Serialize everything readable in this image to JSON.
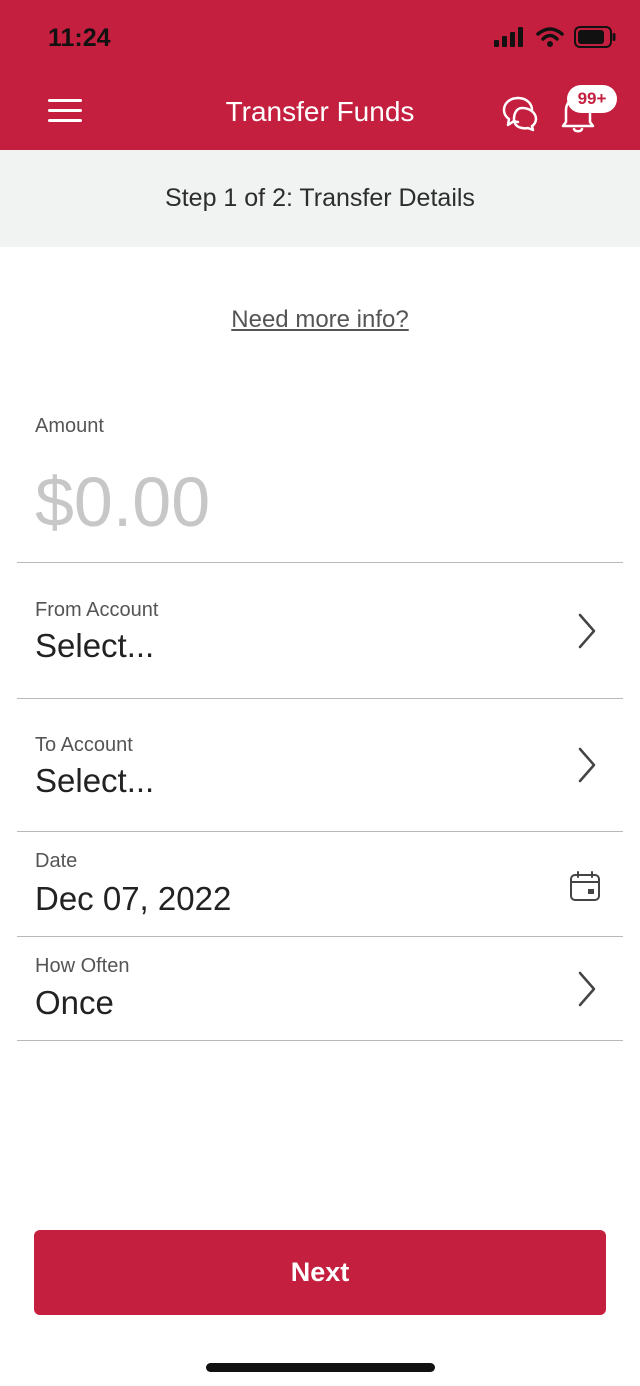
{
  "status_bar": {
    "time": "11:24"
  },
  "header": {
    "title": "Transfer Funds",
    "notification_badge": "99+",
    "brand_color": "#c41f3e"
  },
  "step": {
    "label": "Step 1 of 2: Transfer Details"
  },
  "info_link": "Need more info?",
  "form": {
    "amount": {
      "label": "Amount",
      "placeholder": "$0.00"
    },
    "from_account": {
      "label": "From Account",
      "value": "Select..."
    },
    "to_account": {
      "label": "To Account",
      "value": "Select..."
    },
    "date": {
      "label": "Date",
      "value": "Dec 07, 2022"
    },
    "how_often": {
      "label": "How Often",
      "value": "Once"
    }
  },
  "actions": {
    "next_label": "Next"
  }
}
